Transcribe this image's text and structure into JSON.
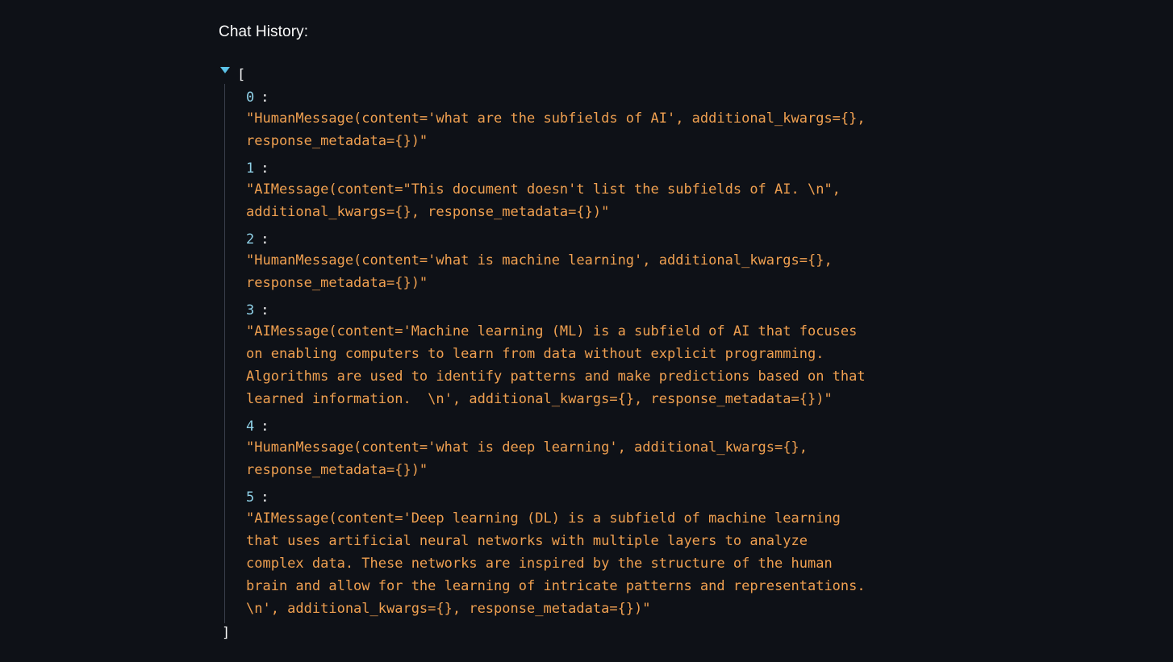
{
  "label": "Chat History:",
  "json": {
    "open": "[",
    "close": "]",
    "items": [
      {
        "key": "0",
        "value": "\"HumanMessage(content='what are the subfields of AI', additional_kwargs={},\nresponse_metadata={})\""
      },
      {
        "key": "1",
        "value": "\"AIMessage(content=\"This document doesn't list the subfields of AI. \\n\",\nadditional_kwargs={}, response_metadata={})\""
      },
      {
        "key": "2",
        "value": "\"HumanMessage(content='what is machine learning', additional_kwargs={},\nresponse_metadata={})\""
      },
      {
        "key": "3",
        "value": "\"AIMessage(content='Machine learning (ML) is a subfield of AI that focuses\non enabling computers to learn from data without explicit programming.\nAlgorithms are used to identify patterns and make predictions based on that\nlearned information.  \\n', additional_kwargs={}, response_metadata={})\""
      },
      {
        "key": "4",
        "value": "\"HumanMessage(content='what is deep learning', additional_kwargs={},\nresponse_metadata={})\""
      },
      {
        "key": "5",
        "value": "\"AIMessage(content='Deep learning (DL) is a subfield of machine learning\nthat uses artificial neural networks with multiple layers to analyze\ncomplex data. These networks are inspired by the structure of the human\nbrain and allow for the learning of intricate patterns and representations.\n\\n', additional_kwargs={}, response_metadata={})\""
      }
    ]
  },
  "colors": {
    "background": "#0e1117",
    "key": "#8fd0e6",
    "string": "#f0a050",
    "toggle": "#5bc2e7"
  }
}
